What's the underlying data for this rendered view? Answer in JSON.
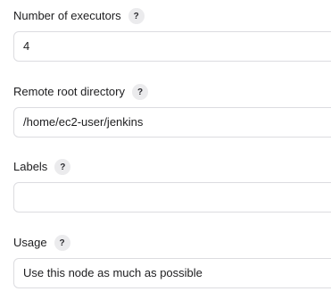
{
  "fields": [
    {
      "label": "Number of executors",
      "help": "?",
      "value": "4"
    },
    {
      "label": "Remote root directory",
      "help": "?",
      "value": "/home/ec2-user/jenkins"
    },
    {
      "label": "Labels",
      "help": "?",
      "value": ""
    },
    {
      "label": "Usage",
      "help": "?",
      "value": "Use this node as much as possible"
    }
  ]
}
